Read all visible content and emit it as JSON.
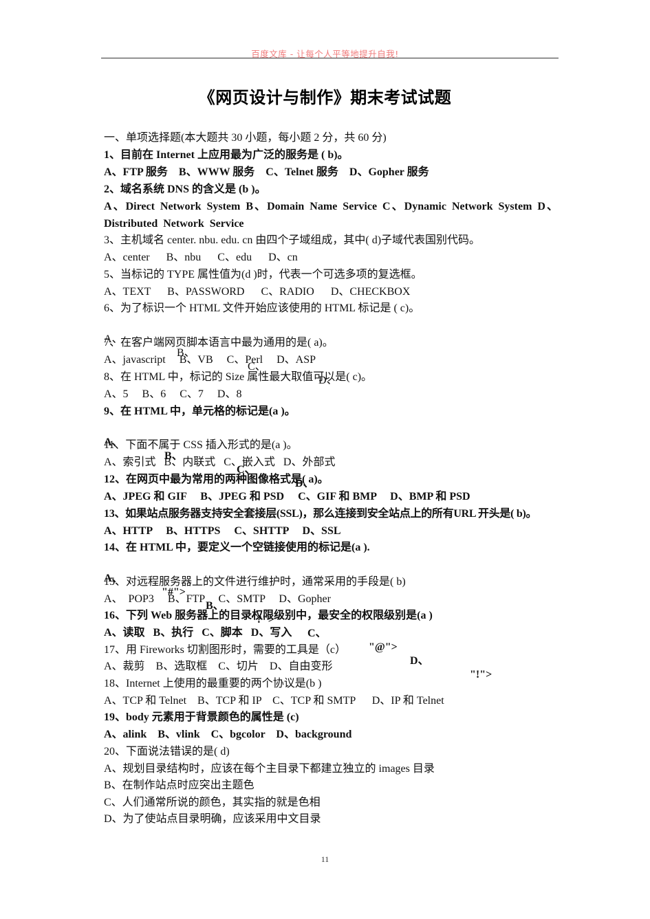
{
  "header": {
    "watermark": "百度文库 - 让每个人平等地提升自我!"
  },
  "title": "《网页设计与制作》期末考试试题",
  "section_heading": "一、单项选择题(本大题共 30 小题，每小题 2 分，共 60 分)",
  "questions": [
    {
      "stem": "1、目前在 Internet 上应用最为广泛的服务是 ( b)。",
      "options": "A、FTP 服务    B、WWW 服务    C、Telnet 服务    D、Gopher 服务"
    },
    {
      "stem": "2、域名系统 DNS 的含义是 (b )。",
      "options": "A、Direct  Network  System  B、Domain  Name  Service  C、Dynamic  Network  System  D、",
      "options_cont": "Distributed  Network  Service"
    },
    {
      "stem": "3、主机域名 center. nbu. edu. cn 由四个子域组成，其中( d)子域代表国别代码。",
      "options": "A、center      B、nbu      C、edu      D、cn"
    },
    {
      "stem": "5、当标记的 TYPE 属性值为(d )时，代表一个可选多项的复选框。",
      "options": "A、TEXT      B、PASSWORD      C、RADIO      D、CHECKBOX"
    },
    {
      "stem": "6、为了标识一个 HTML 文件开始应该使用的 HTML 标记是 ( c)。",
      "option_list": [
        "A、",
        "B、",
        "C、",
        "D、"
      ]
    },
    {
      "stem": "7、在客户端网页脚本语言中最为通用的是( a)。",
      "options": "A、javascript     B、VB     C、Perl     D、ASP"
    },
    {
      "stem": "8、在 HTML 中，标记的 Size 属性最大取值可以是( c)。",
      "options": "A、5     B、6     C、7     D、8"
    },
    {
      "stem": "9、在 HTML 中，单元格的标记是(a )。",
      "option_list": [
        "A、",
        "B、",
        "C、",
        "D、"
      ]
    },
    {
      "stem": "11、下面不属于 CSS 插入形式的是(a )。",
      "options": "A、索引式   B、内联式   C、嵌入式   D、外部式"
    },
    {
      "stem": "12、在网页中最为常用的两种图像格式是( a)。",
      "options": "A、JPEG 和 GIF     B、JPEG 和 PSD     C、GIF 和 BMP     D、BMP 和 PSD"
    },
    {
      "stem": "13、如果站点服务器支持安全套接层(SSL)，那么连接到安全站点上的所有URL 开头是( b)。",
      "options": "A、HTTP     B、HTTPS     C、SHTTP     D、SSL"
    },
    {
      "stem": "14、在 HTML 中，要定义一个空链接使用的标记是(a ).",
      "option_list": [
        "A、",
        "\"#\">",
        "B、",
        "\"?\">",
        "C、",
        "\"@\">",
        "D、",
        "\"!\">"
      ]
    },
    {
      "stem": "15、对远程服务器上的文件进行维护时，通常采用的手段是( b)",
      "options": "A、  POP3     B、FTP     C、SMTP     D、Gopher"
    },
    {
      "stem": "16、下列 Web 服务器上的目录权限级别中，最安全的权限级别是(a )",
      "options": "A、读取   B、执行   C、脚本   D、写入"
    },
    {
      "stem": "17、用 Fireworks 切割图形时，需要的工具是（c）",
      "options": "A、裁剪    B、选取框    C、切片    D、自由变形"
    },
    {
      "stem": "18、Internet 上使用的最重要的两个协议是(b )",
      "options": "A、TCP 和 Telnet    B、TCP 和 IP    C、TCP 和 SMTP      D、IP 和 Telnet"
    },
    {
      "stem": "19、body 元素用于背景颜色的属性是 (c)",
      "options": "A、alink    B、vlink    C、bgcolor    D、background"
    },
    {
      "stem": "20、下面说法错误的是( d)",
      "option_lines": [
        "A、规划目录结构时，应该在每个主目录下都建立独立的 images 目录",
        "B、在制作站点时应突出主题色",
        "C、人们通常所说的颜色，其实指的就是色相",
        "D、为了使站点目录明确，应该采用中文目录"
      ]
    }
  ],
  "page_number": "11"
}
